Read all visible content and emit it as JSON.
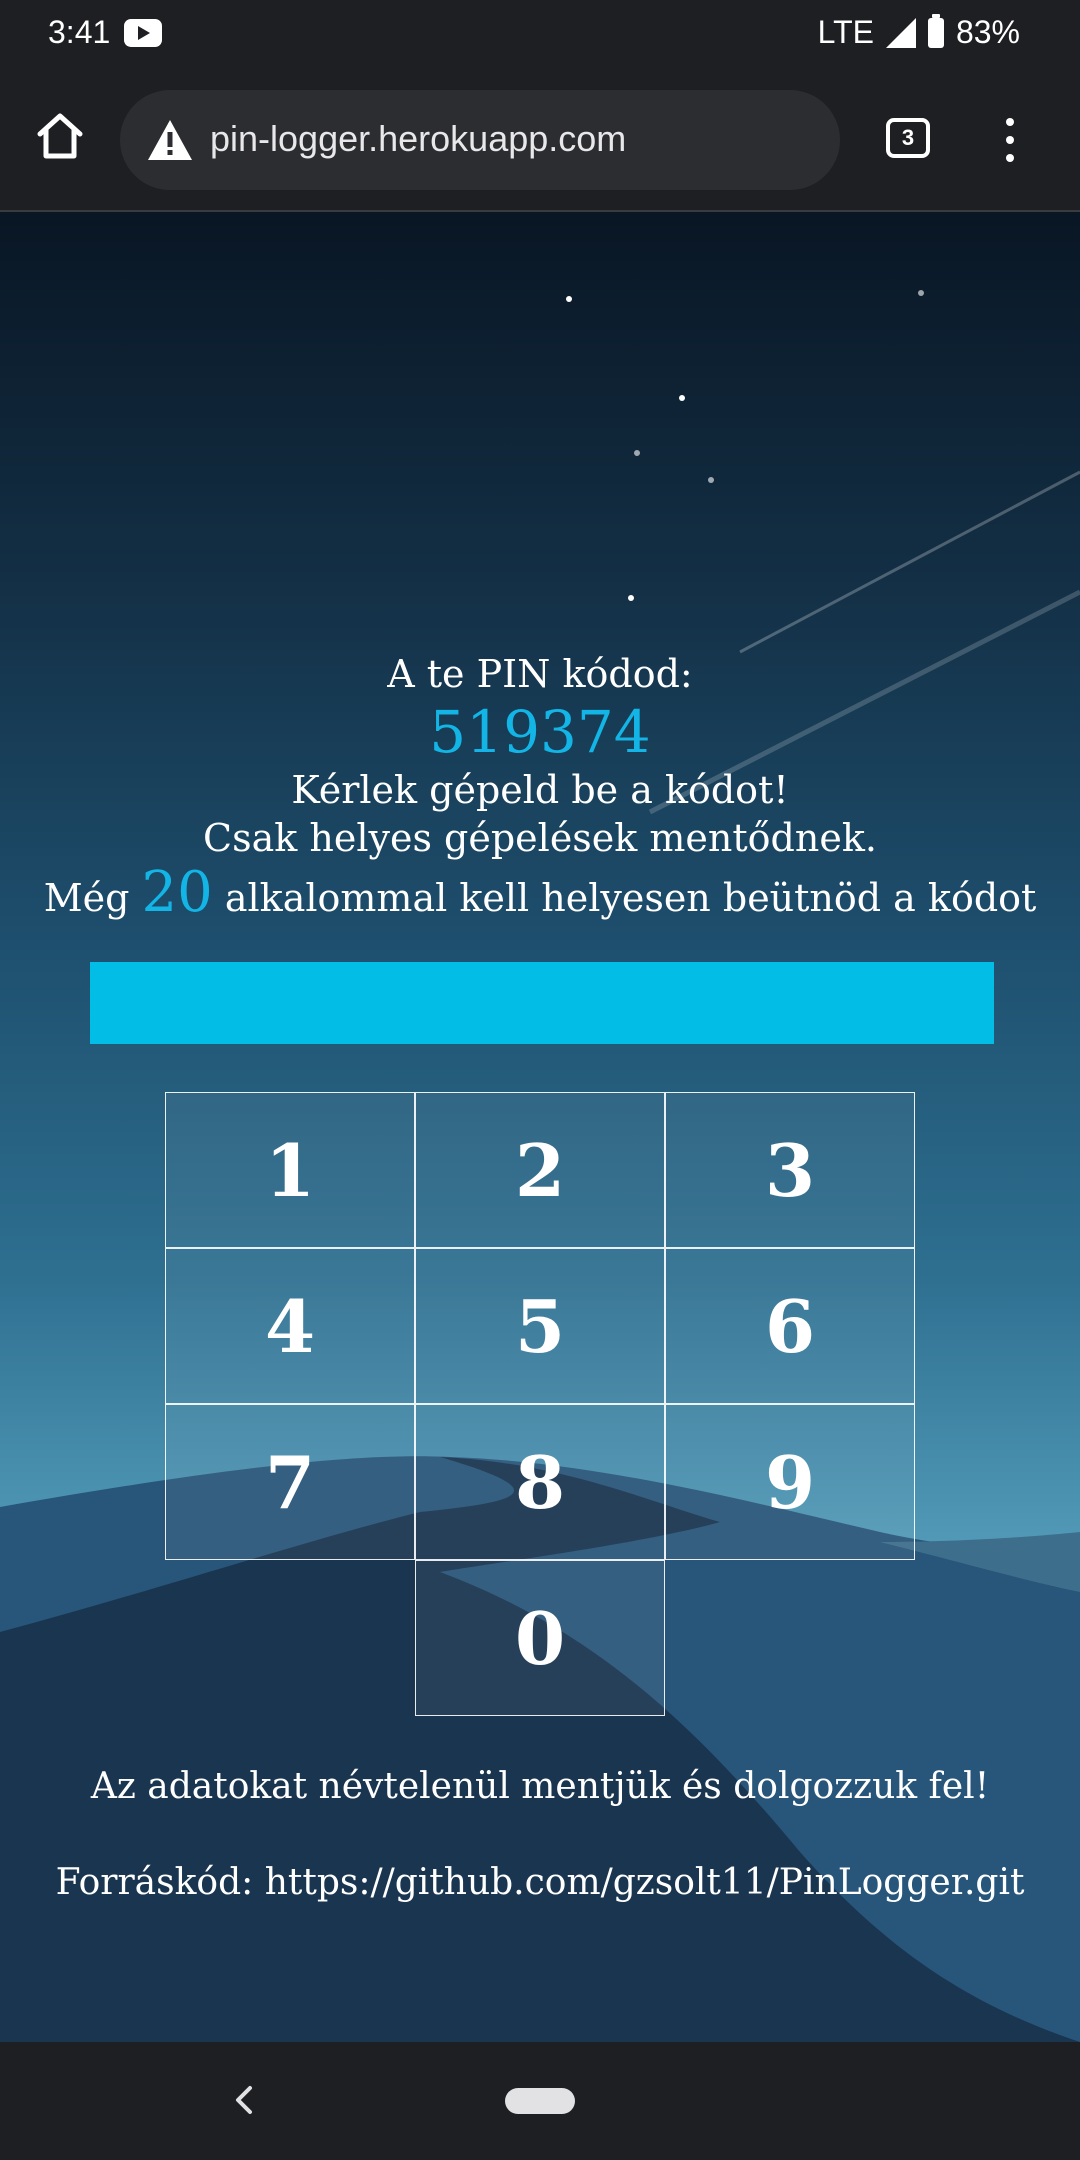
{
  "status_bar": {
    "time": "3:41",
    "network": "LTE",
    "battery": "83%",
    "icons": [
      "youtube-icon",
      "signal-icon",
      "battery-icon"
    ]
  },
  "browser": {
    "url": "pin-logger.herokuapp.com",
    "tab_count": "3",
    "icons": [
      "home-icon",
      "warning-icon",
      "tabs-icon",
      "more-menu-icon"
    ]
  },
  "page": {
    "pin_label": "A te PIN kódod:",
    "pin_code": "519374",
    "instruction_1": "Kérlek gépeld be a kódot!",
    "instruction_2": "Csak helyes gépelések mentődnek.",
    "remaining_prefix": "Még",
    "remaining_count": "20",
    "remaining_suffix": "alkalommal kell helyesen beütnöd a kódot",
    "input_value": "",
    "keys": [
      "1",
      "2",
      "3",
      "4",
      "5",
      "6",
      "7",
      "8",
      "9",
      "0"
    ],
    "footer_note": "Az adatokat névtelenül mentjük és dolgozzuk fel!",
    "source_label": "Forráskód:",
    "source_url": "https://github.com/gzsolt11/PinLogger.git"
  },
  "colors": {
    "accent": "#12b5e6",
    "input_bar": "#02bde6",
    "chrome_bg": "#1e1f23"
  }
}
